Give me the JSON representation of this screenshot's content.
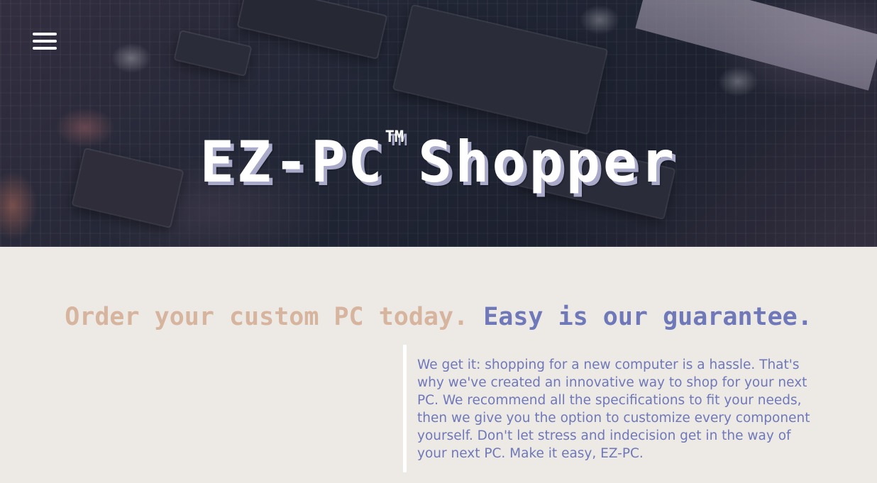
{
  "hero": {
    "title": "EZ-PC",
    "trademark": "TM",
    "title_suffix": "Shopper",
    "menu_icon": "hamburger-menu-icon",
    "background_image": "circuit-board-photo"
  },
  "tagline": {
    "part1": "Order your custom PC today.",
    "part2": "Easy is our guarantee."
  },
  "about": {
    "text": "We get it: shopping for a new computer is a hassle. That's why we've created an innovative way to shop for your next PC. We recommend all the specifications to fit your needs, then we give you the option to customize every component yourself. Don't let stress and indecision get in the way of your next PC. Make it easy, EZ-PC."
  },
  "colors": {
    "background": "#ede9e5",
    "tagline_accent_1": "#d6b49e",
    "tagline_accent_2": "#6f78b9",
    "body_text": "#6f78b9",
    "title_shadow": "#a9a9c9"
  }
}
